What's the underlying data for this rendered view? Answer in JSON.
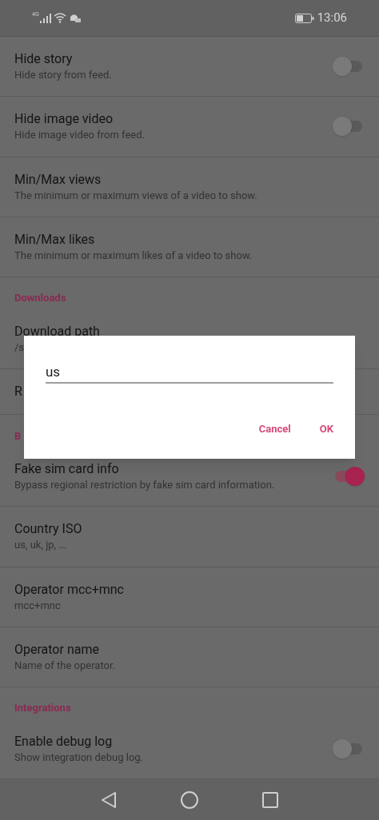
{
  "status_bar": {
    "network": "4G",
    "time": "13:06"
  },
  "settings": [
    {
      "kind": "toggle",
      "title": "Hide story",
      "summary": "Hide story from feed.",
      "on": false
    },
    {
      "kind": "toggle",
      "title": "Hide image video",
      "summary": "Hide image video from feed.",
      "on": false
    },
    {
      "kind": "text",
      "title": "Min/Max views",
      "summary": "The minimum or maximum views of a video to show."
    },
    {
      "kind": "text",
      "title": "Min/Max likes",
      "summary": "The minimum or maximum likes of a video to show."
    },
    {
      "kind": "header",
      "title": "Downloads"
    },
    {
      "kind": "text",
      "title": "Download path",
      "summary": "/s"
    },
    {
      "kind": "text",
      "title": "R"
    },
    {
      "kind": "header",
      "title": "B"
    },
    {
      "kind": "toggle",
      "title": "Fake sim card info",
      "summary": "Bypass regional restriction by fake sim card information.",
      "on": true
    },
    {
      "kind": "text",
      "title": "Country ISO",
      "summary": "us, uk, jp, ..."
    },
    {
      "kind": "text",
      "title": "Operator mcc+mnc",
      "summary": "mcc+mnc"
    },
    {
      "kind": "text",
      "title": "Operator name",
      "summary": "Name of the operator."
    },
    {
      "kind": "header",
      "title": "Integrations"
    },
    {
      "kind": "toggle",
      "title": "Enable debug log",
      "summary": "Show integration debug log.",
      "on": false
    }
  ],
  "dialog": {
    "value": "us",
    "buttons": [
      "Cancel",
      "OK"
    ]
  }
}
